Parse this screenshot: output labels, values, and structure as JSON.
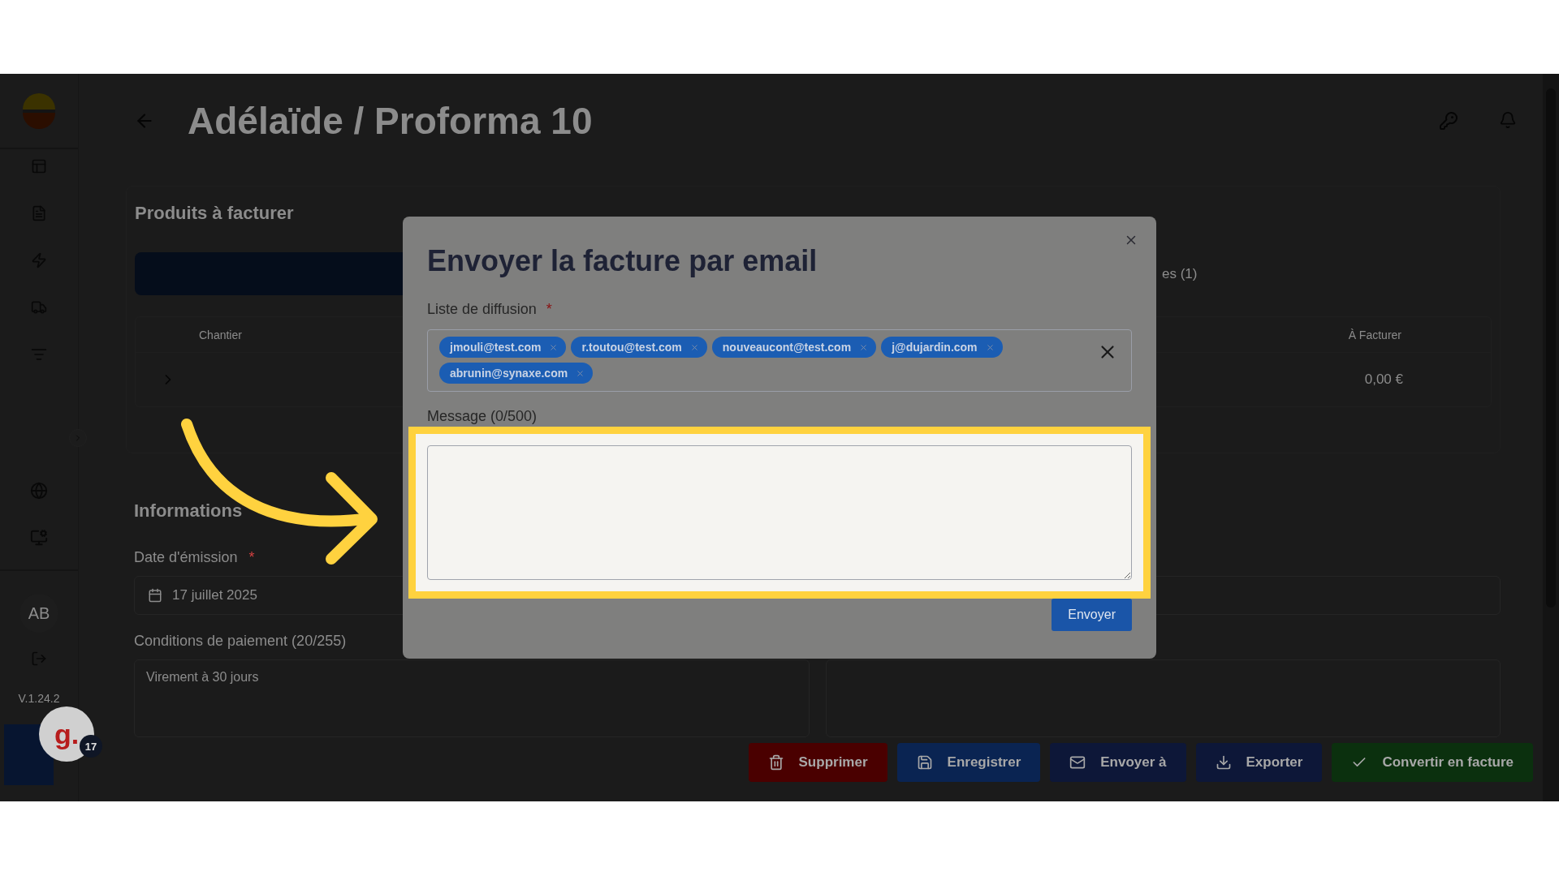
{
  "page": {
    "title": "Adélaïde / Proforma 10"
  },
  "sidebar": {
    "user_initials": "AB",
    "version": "V.1.24.2"
  },
  "chat": {
    "avatar_letter": "g.",
    "badge": "17"
  },
  "products": {
    "heading": "Produits à facturer",
    "tab_fragment": "es (1)",
    "columns": [
      "Chantier",
      "À Facturer"
    ],
    "rows": [
      {
        "amount": "0,00 €",
        "expanded": false
      }
    ]
  },
  "emission": {
    "heading": "Informations",
    "date_label": "Date d'émission",
    "required_mark": "*",
    "date_value": "17 juillet 2025",
    "terms_label": "Conditions de paiement (20/255)",
    "terms_value": "Virement à 30 jours"
  },
  "actions": [
    {
      "label": "Supprimer",
      "kind": "delete"
    },
    {
      "label": "Enregistrer",
      "kind": "save"
    },
    {
      "label": "Envoyer à",
      "kind": "send"
    },
    {
      "label": "Exporter",
      "kind": "export"
    },
    {
      "label": "Convertir en facture",
      "kind": "convert"
    }
  ],
  "modal": {
    "title": "Envoyer la facture par email",
    "recipients_label": "Liste de diffusion",
    "required_mark": "*",
    "recipients": [
      "jmouli@test.com",
      "r.toutou@test.com",
      "nouveaucont@test.com",
      "j@dujardin.com",
      "abrunin@synaxe.com"
    ],
    "message_label": "Message (0/500)",
    "submit": "Envoyer"
  }
}
